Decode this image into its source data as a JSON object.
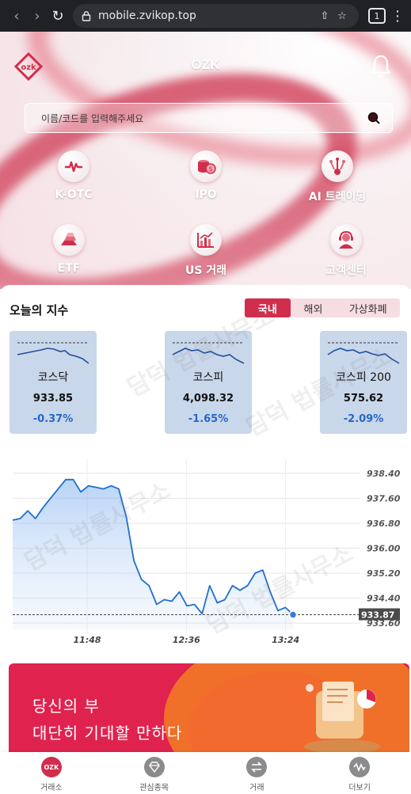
{
  "browser": {
    "url": "mobile.zvikop.top",
    "tab_count": "1"
  },
  "header": {
    "title": "OZK",
    "logo_text": "ozk"
  },
  "search": {
    "placeholder": "이름/코드를 입력해주세요"
  },
  "menu": [
    {
      "label": "K-OTC",
      "icon": "pulse-icon"
    },
    {
      "label": "IPO",
      "icon": "coins-icon"
    },
    {
      "label": "AI 트레이딩",
      "icon": "ai-circuit-icon"
    },
    {
      "label": "ETF",
      "icon": "gold-bars-icon"
    },
    {
      "label": "US 거래",
      "icon": "us-chart-icon"
    },
    {
      "label": "고객센터",
      "icon": "support-agent-icon"
    }
  ],
  "indices": {
    "title": "오늘의 지수",
    "tabs": [
      "국내",
      "해외",
      "가상화폐"
    ],
    "active_tab": "국내",
    "cards": [
      {
        "name": "코스닥",
        "value": "933.85",
        "change": "-0.37%"
      },
      {
        "name": "코스피",
        "value": "4,098.32",
        "change": "-1.65%"
      },
      {
        "name": "코스피 200",
        "value": "575.62",
        "change": "-2.09%"
      }
    ]
  },
  "chart_data": {
    "type": "area",
    "x_ticks": [
      "11:48",
      "12:36",
      "13:24"
    ],
    "y_ticks": [
      "938.40",
      "937.60",
      "936.80",
      "936.00",
      "935.20",
      "934.40",
      "933.60"
    ],
    "ylim": [
      933.4,
      938.6
    ],
    "current_label": "933.87",
    "current_value": 933.87,
    "series": [
      {
        "values": [
          936.9,
          936.95,
          937.2,
          936.95,
          937.3,
          937.6,
          937.9,
          938.2,
          938.2,
          937.8,
          938.0,
          937.95,
          937.9,
          938.0,
          937.9,
          937.0,
          935.6,
          935.0,
          934.8,
          934.2,
          934.35,
          934.3,
          934.6,
          934.15,
          934.2,
          933.9,
          934.8,
          934.25,
          934.35,
          934.8,
          934.65,
          934.8,
          935.2,
          935.3,
          934.6,
          934.0,
          934.1,
          933.87
        ]
      }
    ],
    "color": "#1f6fd0"
  },
  "banner": {
    "line1": "당신의 부",
    "line2": "대단히 기대할 만하다"
  },
  "tabbar": [
    {
      "label": "거래소",
      "icon": "ozk-logo-icon",
      "active": true
    },
    {
      "label": "관심종목",
      "icon": "diamond-icon",
      "active": false
    },
    {
      "label": "거래",
      "icon": "exchange-arrows-icon",
      "active": false
    },
    {
      "label": "더보기",
      "icon": "wave-icon",
      "active": false
    }
  ],
  "watermark": "담덕 법률사무소",
  "colors": {
    "accent": "#d12d4c",
    "negative": "#2468c8",
    "card_bg": "#c9d7ea"
  }
}
